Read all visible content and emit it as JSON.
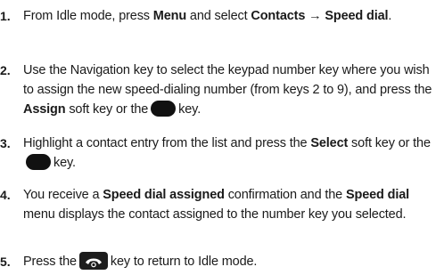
{
  "steps": [
    {
      "num": "1.",
      "p1": "From Idle mode, press ",
      "b1": "Menu",
      "p2": " and select ",
      "b2": "Contacts",
      "p3": " → ",
      "b3": "Speed dial",
      "p4": "."
    },
    {
      "num": "2.",
      "p1": "Use the Navigation key to select the keypad number key where you wish to assign the new speed-dialing number (from keys 2 to 9), and press the ",
      "b1": "Assign",
      "p2": " soft key or the",
      "p3": "key."
    },
    {
      "num": "3.",
      "p1": "Highlight a contact entry from the list and press the ",
      "b1": "Select",
      "p2": " soft key or the",
      "p3": "key."
    },
    {
      "num": "4.",
      "p1": "You receive a ",
      "b1": "Speed dial assigned",
      "p2": " confirmation and the ",
      "b2": "Speed dial",
      "p3": " menu displays the contact assigned to the number key you selected."
    },
    {
      "num": "5.",
      "p1": "Press the",
      "p2": "key to return to Idle mode."
    }
  ],
  "icons": {
    "ok_key": "center-select-key-icon",
    "end_key": "end-power-key-icon"
  }
}
